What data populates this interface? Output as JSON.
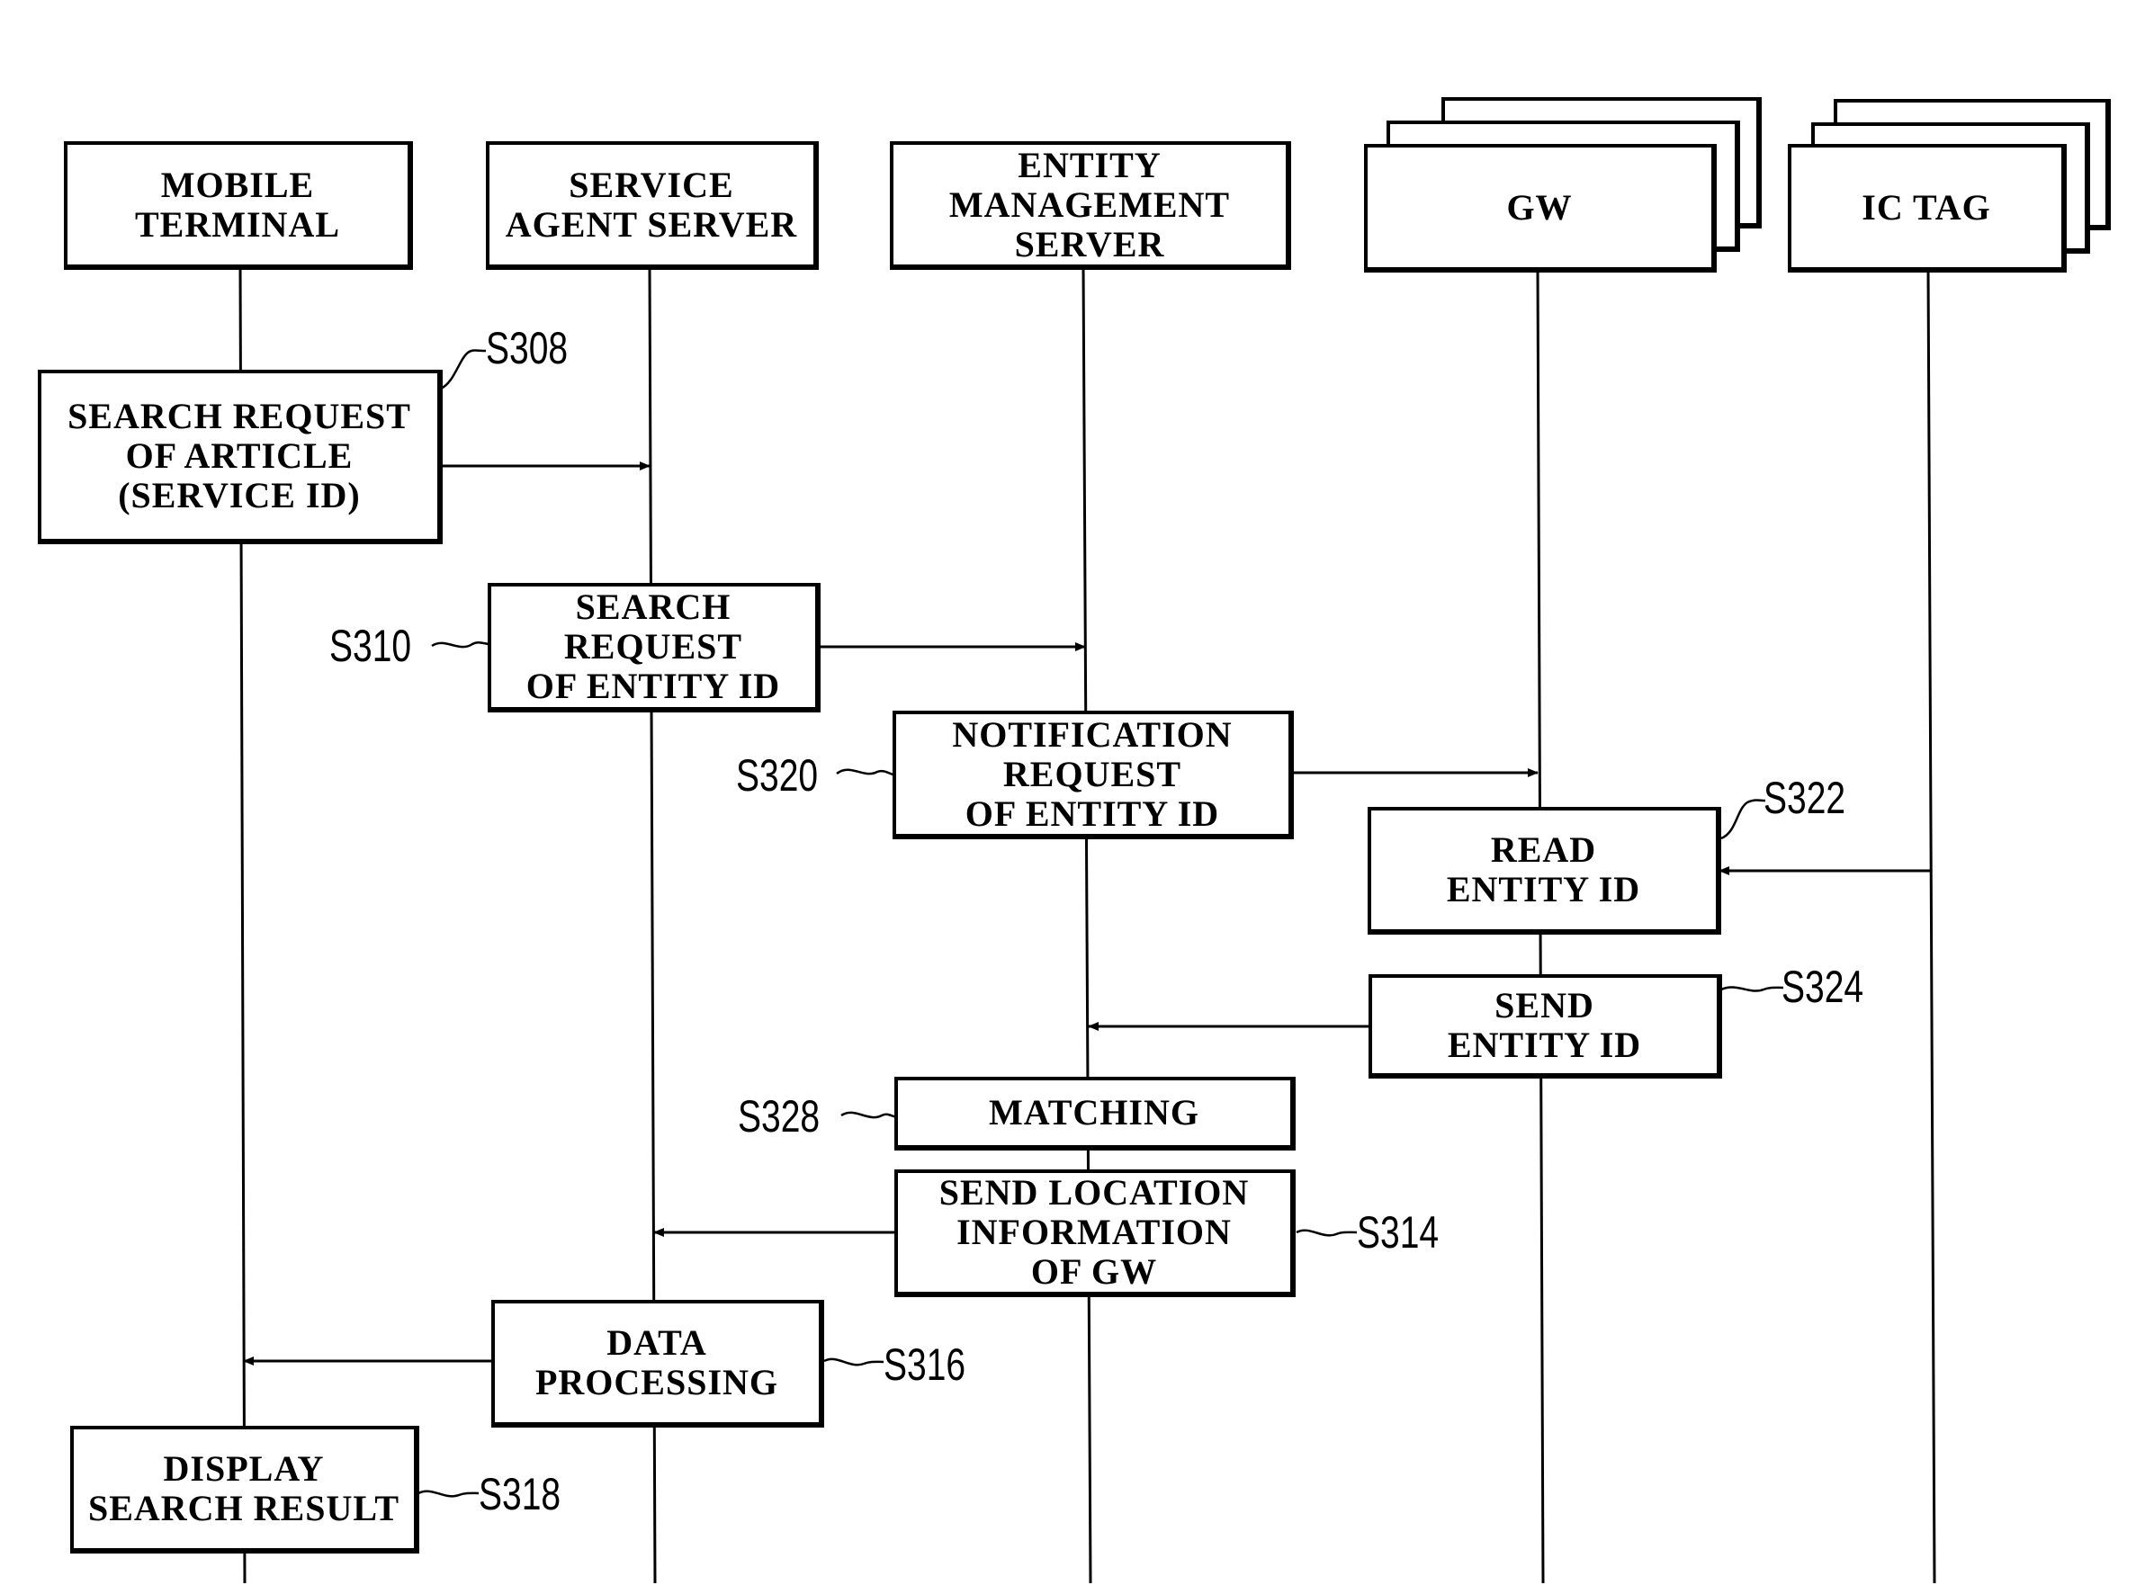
{
  "lifelines": [
    {
      "id": "mobile",
      "label": "MOBILE\nTERMINAL"
    },
    {
      "id": "sas",
      "label": "SERVICE\nAGENT SERVER"
    },
    {
      "id": "ems",
      "label": "ENTITY\nMANAGEMENT\nSERVER"
    },
    {
      "id": "gw",
      "label": "GW",
      "stacked": true
    },
    {
      "id": "ictag",
      "label": "IC TAG",
      "stacked": true
    }
  ],
  "steps": [
    {
      "id": "S308",
      "label": "S308",
      "text": "SEARCH REQUEST\nOF ARTICLE\n(SERVICE ID)",
      "lane": "mobile",
      "arrow_to": "sas"
    },
    {
      "id": "S310",
      "label": "S310",
      "text": "SEARCH REQUEST\nOF ENTITY ID",
      "lane": "sas",
      "arrow_to": "ems"
    },
    {
      "id": "S320",
      "label": "S320",
      "text": "NOTIFICATION\nREQUEST\nOF ENTITY ID",
      "lane": "ems",
      "arrow_to": "gw"
    },
    {
      "id": "S322",
      "label": "S322",
      "text": "READ\nENTITY ID",
      "lane": "gw",
      "arrow_from": "ictag"
    },
    {
      "id": "S324",
      "label": "S324",
      "text": "SEND\nENTITY ID",
      "lane": "gw",
      "arrow_to": "ems"
    },
    {
      "id": "S328",
      "label": "S328",
      "text": "MATCHING",
      "lane": "ems"
    },
    {
      "id": "S314",
      "label": "S314",
      "text": "SEND LOCATION\nINFORMATION\nOF GW",
      "lane": "ems",
      "arrow_to": "sas"
    },
    {
      "id": "S316",
      "label": "S316",
      "text": "DATA\nPROCESSING",
      "lane": "sas",
      "arrow_to": "mobile"
    },
    {
      "id": "S318",
      "label": "S318",
      "text": "DISPLAY\nSEARCH RESULT",
      "lane": "mobile"
    }
  ]
}
